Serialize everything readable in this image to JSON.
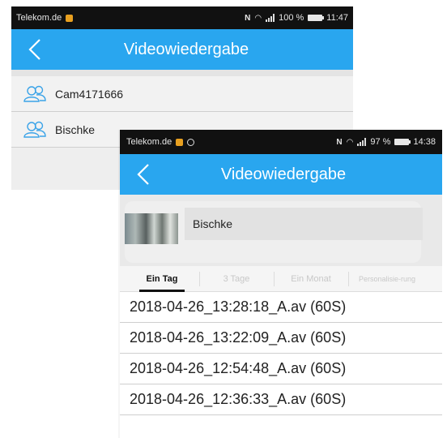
{
  "back_screen": {
    "status": {
      "carrier": "Telekom.de",
      "battery": "100 %",
      "time": "11:47"
    },
    "header": {
      "title": "Videowiedergabe"
    },
    "cameras": [
      {
        "label": "Cam4171666",
        "icon": "users-icon"
      },
      {
        "label": "Bischke",
        "icon": "users-icon"
      }
    ]
  },
  "front_screen": {
    "status": {
      "carrier": "Telekom.de",
      "battery": "97 %",
      "time": "14:38"
    },
    "header": {
      "title": "Videowiedergabe"
    },
    "device": {
      "name": "Bischke"
    },
    "tabs": [
      {
        "label": "Ein Tag",
        "active": true
      },
      {
        "label": "3 Tage",
        "active": false
      },
      {
        "label": "Ein Monat",
        "active": false
      },
      {
        "label": "Personalisie-rung",
        "active": false
      }
    ],
    "files": [
      "2018-04-26_13:28:18_A.av (60S)",
      "2018-04-26_13:22:09_A.av (60S)",
      "2018-04-26_12:54:48_A.av (60S)",
      "2018-04-26_12:36:33_A.av (60S)"
    ]
  },
  "colors": {
    "accent": "#29a6ef",
    "statusbar": "#111111"
  }
}
